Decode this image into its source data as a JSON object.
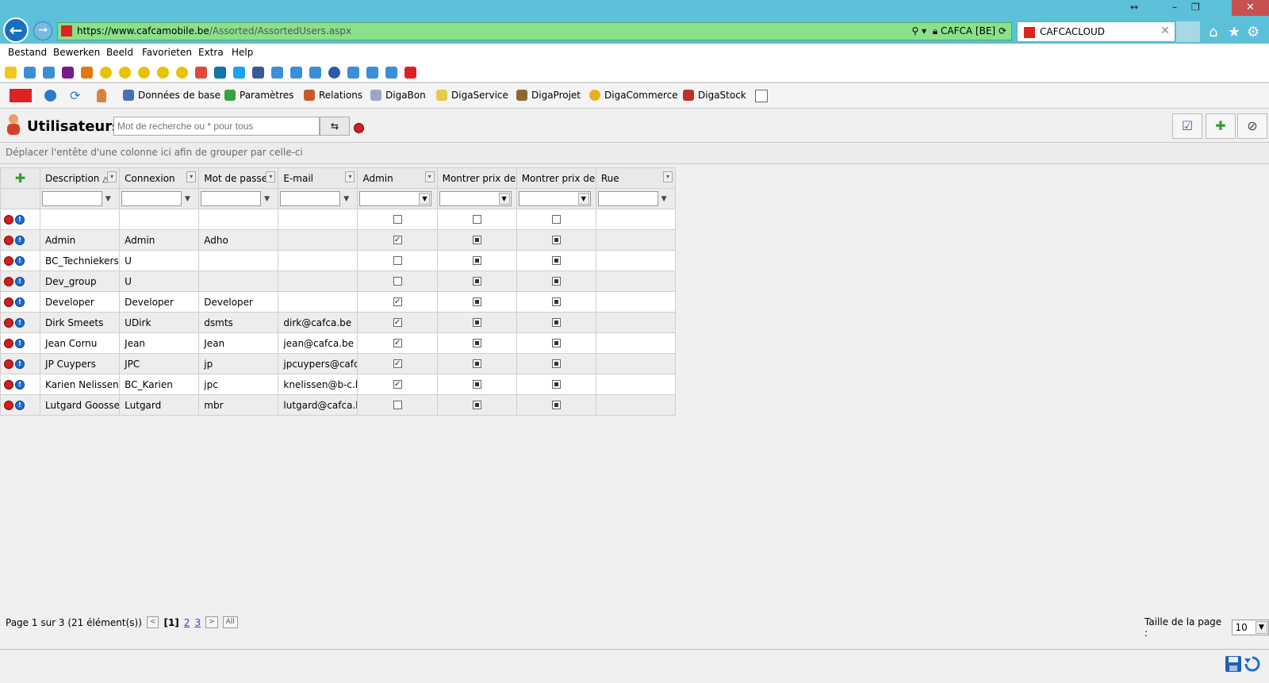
{
  "browser": {
    "url_host": "https://www.cafcamobile.be",
    "url_path": "/Assorted/AssortedUsers.aspx",
    "site_identity": "CAFCA [BE]",
    "tab_title": "CAFCACLOUD"
  },
  "menu": [
    "Bestand",
    "Bewerken",
    "Beeld",
    "Favorieten",
    "Extra",
    "Help"
  ],
  "app_toolbar": [
    {
      "label": "Données de base",
      "icon": "database-icon"
    },
    {
      "label": "Paramètres",
      "icon": "settings-icon"
    },
    {
      "label": "Relations",
      "icon": "relations-icon"
    },
    {
      "label": "DigaBon",
      "icon": "digabon-icon"
    },
    {
      "label": "DigaService",
      "icon": "digaservice-icon"
    },
    {
      "label": "DigaProjet",
      "icon": "digaprojet-icon"
    },
    {
      "label": "DigaCommerce",
      "icon": "digacommerce-icon"
    },
    {
      "label": "DigaStock",
      "icon": "digastock-icon"
    }
  ],
  "page": {
    "title": "Utilisateurs",
    "search_placeholder": "Mot de recherche ou * pour tous",
    "group_hint": "Déplacer l'entête d'une colonne ici afin de grouper par celle-ci"
  },
  "grid": {
    "columns": [
      "Description",
      "Connexion",
      "Mot de passe",
      "E-mail",
      "Admin",
      "Montrer prix de ve",
      "Montrer prix de re",
      "Rue"
    ],
    "rows": [
      {
        "description": "",
        "connexion": "",
        "password": "",
        "email": "",
        "admin": "unchecked",
        "c1": "unchecked",
        "c2": "unchecked",
        "rue": ""
      },
      {
        "description": "Admin",
        "connexion": "Admin",
        "password": "Adho",
        "email": "",
        "admin": "checked",
        "c1": "indeterminate",
        "c2": "indeterminate",
        "rue": ""
      },
      {
        "description": "BC_Techniekers",
        "connexion": "U",
        "password": "",
        "email": "",
        "admin": "unchecked",
        "c1": "indeterminate",
        "c2": "indeterminate",
        "rue": ""
      },
      {
        "description": "Dev_group",
        "connexion": "U",
        "password": "",
        "email": "",
        "admin": "unchecked",
        "c1": "indeterminate",
        "c2": "indeterminate",
        "rue": ""
      },
      {
        "description": "Developer",
        "connexion": "Developer",
        "password": "Developer",
        "email": "",
        "admin": "checked",
        "c1": "indeterminate",
        "c2": "indeterminate",
        "rue": ""
      },
      {
        "description": "Dirk Smeets",
        "connexion": "UDirk",
        "password": "dsmts",
        "email": "dirk@cafca.be",
        "admin": "checked",
        "c1": "indeterminate",
        "c2": "indeterminate",
        "rue": ""
      },
      {
        "description": "Jean Cornu",
        "connexion": "Jean",
        "password": "Jean",
        "email": "jean@cafca.be",
        "admin": "checked",
        "c1": "indeterminate",
        "c2": "indeterminate",
        "rue": ""
      },
      {
        "description": "JP Cuypers",
        "connexion": "JPC",
        "password": "jp",
        "email": "jpcuypers@cafca.",
        "admin": "checked",
        "c1": "indeterminate",
        "c2": "indeterminate",
        "rue": ""
      },
      {
        "description": "Karien Nelissen",
        "connexion": "BC_Karien",
        "password": "jpc",
        "email": "knelissen@b-c.be",
        "admin": "checked",
        "c1": "indeterminate",
        "c2": "indeterminate",
        "rue": ""
      },
      {
        "description": "Lutgard Goossens",
        "connexion": "Lutgard",
        "password": "mbr",
        "email": "lutgard@cafca.be",
        "admin": "unchecked",
        "c1": "indeterminate",
        "c2": "indeterminate",
        "rue": ""
      }
    ]
  },
  "pager": {
    "summary": "Page 1 sur 3 (21 élément(s))",
    "current": "[1]",
    "pages": [
      "2",
      "3"
    ],
    "all_label": "All",
    "page_size_label": "Taille de la page :",
    "page_size": "10"
  },
  "colors": {
    "chrome": "#5bc0d8",
    "address_bar": "#8be08b",
    "accent": "#1670c2"
  }
}
